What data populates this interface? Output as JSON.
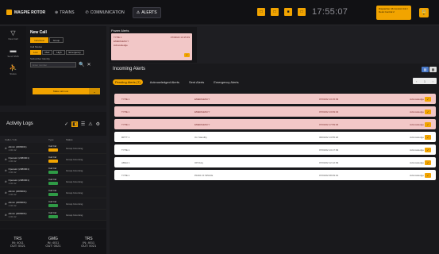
{
  "header": {
    "logo_text": "MAGPIE ROTOR",
    "tabs": [
      {
        "icon": "compass-icon",
        "label": "TRAINS",
        "glyph": "⊕"
      },
      {
        "icon": "phone-icon",
        "label": "COMMUNICATION",
        "glyph": "✆"
      },
      {
        "icon": "warning-icon",
        "label": "ALERTS",
        "glyph": "⚠"
      }
    ],
    "active_tab": "ALERTS",
    "square_buttons": [
      "□",
      "□",
      "■",
      "□"
    ],
    "clock": "17:55:07",
    "user_text": "Dispatcher 46 Control Unit / Desk Central 2",
    "lock_glyph": "🔒"
  },
  "rail": [
    {
      "glyph": "▽",
      "label": "New Call"
    },
    {
      "glyph": "▬",
      "label": "Send SMS"
    },
    {
      "glyph": "⛹",
      "label": "Status"
    }
  ],
  "new_call": {
    "title": "New Call",
    "toggle": [
      "Individual",
      "Group"
    ],
    "toggle_on": "Individual",
    "call_mode_label": "Call Modes",
    "chips": [
      "Low",
      "Med",
      "High",
      "Emergency"
    ],
    "chips_on": "Low",
    "identity_label": "Subscriber Identity",
    "identity_placeholder": "Enter number",
    "search_glyph": "🔍",
    "clear_glyph": "✕",
    "make_call_label": "Make call now",
    "make_call_arrow": "⌄"
  },
  "activity": {
    "title": "Activity Logs",
    "icons": [
      "✓",
      "◧",
      "☰",
      "⚠",
      "⚙"
    ],
    "columns": [
      "Caller / Info",
      "Type",
      "Status"
    ],
    "rows": [
      {
        "name": "Admin (2080001)",
        "sub": "1:00:42",
        "type": "Call Ind",
        "pill": "#f2a400",
        "status": "Group Incoming"
      },
      {
        "name": "Operator (2080001)",
        "sub": "1:00:42",
        "type": "Call Ind",
        "pill": "#f2a400",
        "status": "Group Incoming"
      },
      {
        "name": "Operator (2080001)",
        "sub": "1:00:42",
        "type": "Call Ind",
        "pill": "#2f9b46",
        "status": "Group Incoming"
      },
      {
        "name": "Operator (2080001)",
        "sub": "1:00:42",
        "type": "Call Ind",
        "pill": "#2f9b46",
        "status": "Group Incoming"
      },
      {
        "name": "Admin (2080001)",
        "sub": "1:00:42",
        "type": "Call Ind",
        "pill": "#2f9b46",
        "status": "Group Incoming"
      },
      {
        "name": "Admin (2080001)",
        "sub": "1:00:42",
        "type": "Call Ind",
        "pill": "#2f9b46",
        "status": "Group Incoming"
      },
      {
        "name": "Admin (2080001)",
        "sub": "1:00:42",
        "type": "Call Ind",
        "pill": "#2f9b46",
        "status": "Group Incoming"
      }
    ]
  },
  "stats": [
    {
      "key": "TRS",
      "lines": [
        "IN: 4011",
        "OUT: 0021"
      ]
    },
    {
      "key": "GMG",
      "lines": [
        "IN: 4011",
        "OUT: 0021"
      ]
    },
    {
      "key": "TRS",
      "lines": [
        "IN: 4011",
        "OUT: 0021"
      ]
    }
  ],
  "power_alerts": {
    "title": "Power Alerts",
    "card": {
      "line1": "TYPE 1",
      "line1_time": "07/03/22 13:15:39",
      "line2": "EMERGENCY",
      "line3": "Acknowledge",
      "ack": "✓"
    }
  },
  "incoming": {
    "title": "Incoming Alerts",
    "view_icons": [
      "▤",
      "▦"
    ],
    "filters": [
      "Pending Alerts (7)",
      "Acknowledged Alerts",
      "Sent Alerts",
      "Emergency Alerts"
    ],
    "active_filter": "Pending Alerts (7)",
    "pager": [
      "‹",
      "1",
      "›"
    ],
    "rows": [
      {
        "name": "TYPE 1",
        "type": "EMERGENCY",
        "time": "07/03/22 13:15:39",
        "ack": "Acknowledge",
        "kind": "alarm"
      },
      {
        "name": "TYPE 1",
        "type": "EMERGENCY",
        "time": "07/03/22 13:09:43",
        "ack": "Acknowledge",
        "kind": "alarm"
      },
      {
        "name": "TYPE 1",
        "type": "EMERGENCY",
        "time": "07/03/22 17:59:46",
        "ack": "Acknowledge",
        "kind": "alarm"
      },
      {
        "name": "RPTT 1",
        "type": "On Standby",
        "time": "06/03/22 13:55:20",
        "ack": "Acknowledge",
        "kind": "normal"
      },
      {
        "name": "TYPE 1",
        "type": "",
        "time": "07/03/22 13:17:09",
        "ack": "Acknowledge",
        "kind": "normal"
      },
      {
        "name": "ABHA 1",
        "type": "Off Duty",
        "time": "07/03/22 12:12:09",
        "ack": "Acknowledge",
        "kind": "normal"
      },
      {
        "name": "TYPE 1",
        "type": "PANIC IF SPACE",
        "time": "07/03/22 08:09:01",
        "ack": "Acknowledge",
        "kind": "normal"
      }
    ]
  }
}
